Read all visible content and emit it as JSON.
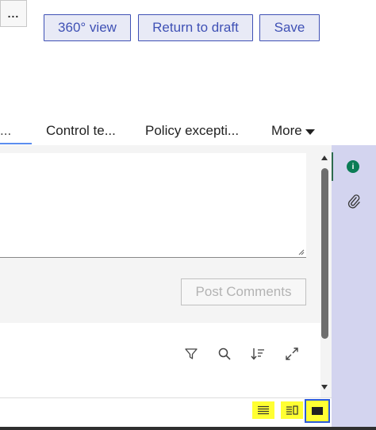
{
  "toolbar": {
    "view360_label": "360° view",
    "return_draft_label": "Return to draft",
    "save_label": "Save",
    "more_label": "..."
  },
  "tabs": [
    {
      "label": "..."
    },
    {
      "label": "Control te..."
    },
    {
      "label": "Policy excepti..."
    },
    {
      "label": "More"
    }
  ],
  "comments": {
    "post_label": "Post Comments"
  },
  "icons": {
    "filter": "filter-icon",
    "search": "search-icon",
    "sort": "sort-icon",
    "expand": "expand-icon",
    "info": "info-icon",
    "attachment": "paperclip-icon",
    "view_list": "list-view-icon",
    "view_split": "split-view-icon",
    "view_full": "full-view-icon"
  },
  "rail": {
    "info_glyph": "i"
  },
  "colors": {
    "accent": "#3f51b5",
    "rail_bg": "#d3d4ef",
    "info_green": "#0b7c55",
    "highlight": "#ffff33",
    "selected_border": "#2c5bd8"
  }
}
